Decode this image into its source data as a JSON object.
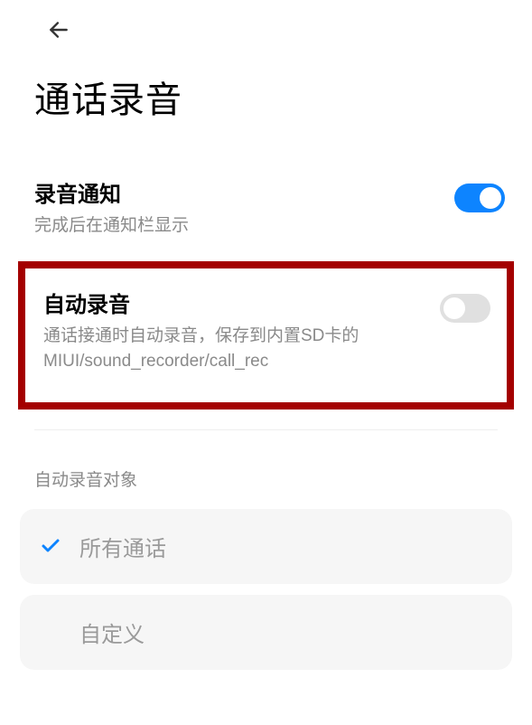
{
  "header": {
    "title": "通话录音"
  },
  "settings": {
    "notification": {
      "title": "录音通知",
      "subtitle": "完成后在通知栏显示",
      "enabled": true
    },
    "auto_record": {
      "title": "自动录音",
      "subtitle": "通话接通时自动录音，保存到内置SD卡的MIUI/sound_recorder/call_rec",
      "enabled": false
    }
  },
  "section": {
    "label": "自动录音对象",
    "options": {
      "all_calls": {
        "label": "所有通话",
        "selected": true
      },
      "custom": {
        "label": "自定义",
        "selected": false
      }
    }
  }
}
